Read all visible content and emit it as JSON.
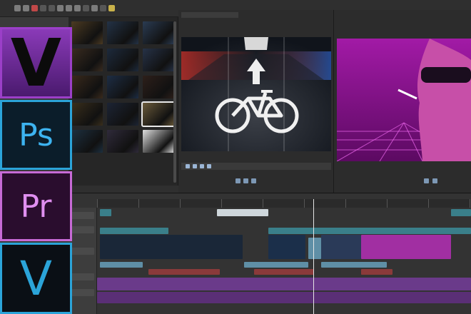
{
  "app_icons": [
    {
      "name": "vegas-pro",
      "label": "V",
      "bg": "#2d0e36",
      "border": "#9b3fc8",
      "color": "#0b0b0b"
    },
    {
      "name": "photoshop",
      "label": "Ps",
      "bg": "#0b1d2a",
      "border": "#2ba4d9",
      "color": "#3db3f0"
    },
    {
      "name": "premiere-pro",
      "label": "Pr",
      "bg": "#2a0d2e",
      "border": "#c76ad6",
      "color": "#e08ff0"
    },
    {
      "name": "vegas-movie-studio",
      "label": "V",
      "bg": "#0a0f15",
      "border": "#2ba4d9",
      "color": "#2ba4d9"
    }
  ],
  "toolbar": {
    "icons": [
      "open-icon",
      "save-icon",
      "undo-icon",
      "redo-icon",
      "cut-icon",
      "copy-icon",
      "paste-icon",
      "render-icon",
      "settings-icon"
    ]
  },
  "media_browser": {
    "selected_index": 11,
    "thumbnails": [
      "#4b3a22",
      "#233246",
      "#2a3b52",
      "#3a2c20",
      "#1d2a3c",
      "#263247",
      "#3a2a1c",
      "#1d2d44",
      "#2d1f1a",
      "#3a2f1c",
      "#1c2434",
      "#6a5a3a",
      "#1d3040",
      "#2f2a3a",
      "#e0e0e0"
    ]
  },
  "trimmer": {
    "title": ""
  },
  "preview": {
    "accent": "#d03bd0"
  },
  "timeline": {
    "ruler_labels": [
      "",
      "",
      "",
      "",
      "",
      "",
      ""
    ],
    "colors": {
      "video": "#3a7f8a",
      "audio": "#6a3a8a",
      "audio_red": "#8a3a3a",
      "selection": "#5f8fa6"
    }
  }
}
